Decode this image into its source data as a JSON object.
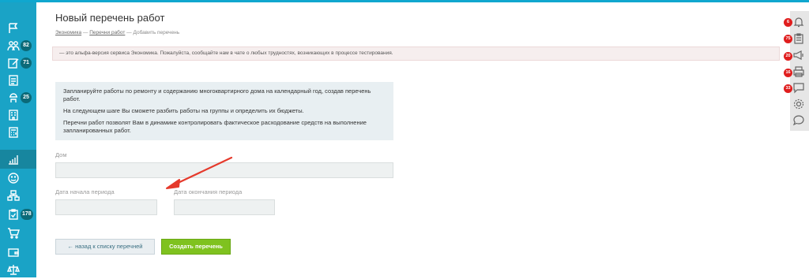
{
  "page": {
    "title": "Новый перечень работ",
    "breadcrumb": {
      "items": [
        "Экономика",
        "Перечни работ"
      ],
      "separator": " — ",
      "current": "Добавить перечень"
    }
  },
  "alert": {
    "text": "— это альфа-версия сервиса Экономика. Пожалуйста, сообщайте нам в чате о любых трудностях, возникающих в процессе тестирования."
  },
  "info": {
    "paragraphs": [
      "Запланируйте работы по ремонту и содержанию многоквартирного дома на календарный год, создав перечень работ.",
      "На следующем шаге Вы сможете разбить работы на группы и определить их бюджеты.",
      "Перечни работ позволят Вам в динамике контролировать фактическое расходование средств на выполнение запланированных работ."
    ]
  },
  "form": {
    "house_label": "Дом",
    "house_value": "",
    "start_label": "Дата начала периода",
    "start_value": "",
    "end_label": "Дата окончания периода",
    "end_value": ""
  },
  "buttons": {
    "back": "← назад к списку перечней",
    "create": "Создать перечень"
  },
  "sidebar": {
    "items": [
      {
        "icon": "flag-icon",
        "badge": ""
      },
      {
        "icon": "team-icon",
        "badge": "82"
      },
      {
        "icon": "edit-icon",
        "badge": "71"
      },
      {
        "icon": "documents-icon",
        "badge": ""
      },
      {
        "icon": "worker-icon",
        "badge": "25"
      },
      {
        "icon": "building-icon",
        "badge": ""
      },
      {
        "icon": "calculator-icon",
        "badge": ""
      },
      {
        "icon": "analytics-icon",
        "badge": ""
      },
      {
        "icon": "smiley-icon",
        "badge": ""
      },
      {
        "icon": "structure-icon",
        "badge": ""
      },
      {
        "icon": "clipboard-check-icon",
        "badge": "178"
      },
      {
        "icon": "cart-icon",
        "badge": ""
      },
      {
        "icon": "wallet-icon",
        "badge": ""
      },
      {
        "icon": "scales-icon",
        "badge": ""
      }
    ]
  },
  "right_panel": {
    "items": [
      {
        "icon": "bell-icon",
        "badge": "6"
      },
      {
        "icon": "clipboard-icon",
        "badge": "75"
      },
      {
        "icon": "megaphone-icon",
        "badge": "20"
      },
      {
        "icon": "printer-icon",
        "badge": "16"
      },
      {
        "icon": "message-icon",
        "badge": "33"
      },
      {
        "icon": "gear-icon",
        "badge": ""
      },
      {
        "icon": "chat-icon",
        "badge": ""
      }
    ]
  },
  "colors": {
    "sidebar": "#1aa3c6",
    "sidebar_badge": "#0b6a78",
    "primary_button": "#7fc21f",
    "alert_bg": "#f6eeee",
    "info_bg": "#e8eff2",
    "notification_badge": "#e01e1e",
    "annotation_arrow": "#e53a2c"
  }
}
